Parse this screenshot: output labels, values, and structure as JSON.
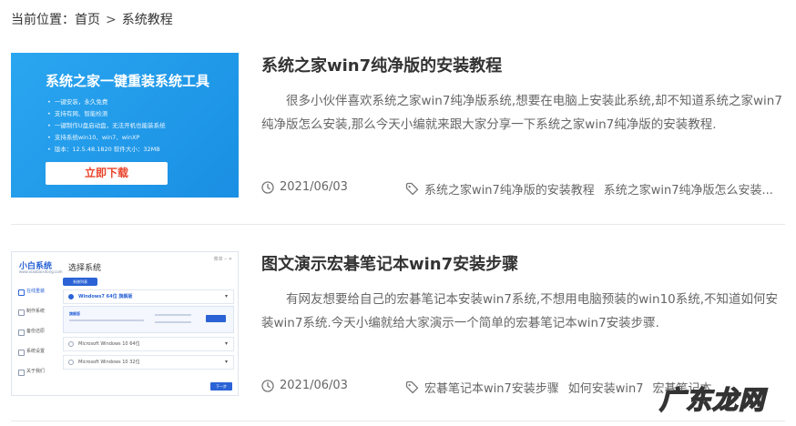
{
  "breadcrumb": {
    "prefix": "当前位置：",
    "home": "首页",
    "separator": ">",
    "current": "系统教程"
  },
  "articles": [
    {
      "title": "系统之家win7纯净版的安装教程",
      "excerpt": "很多小伙伴喜欢系统之家win7纯净版系统,想要在电脑上安装此系统,却不知道系统之家win7纯净版怎么安装,那么今天小编就来跟大家分享一下系统之家win7纯净版的安装教程.",
      "date": "2021/06/03",
      "tags": [
        "系统之家win7纯净版的安装教程",
        "系统之家win7纯净版怎么安装..."
      ],
      "thumb": {
        "title": "系统之家一键重装系统工具",
        "bullets": [
          "一键安装，永久免费",
          "支持有网、智能检测",
          "一键制作U盘启动盘，无法开机也能装系统",
          "支持系统win10、win7、winXP",
          "版本：12.5.48.1820  软件大小：32MB"
        ],
        "button": "立即下载"
      }
    },
    {
      "title": "图文演示宏碁笔记本win7安装步骤",
      "excerpt": "有网友想要给自己的宏碁笔记本安装win7系统,不想用电脑预装的win10系统,不知道如何安装win7系统.今天小编就给大家演示一个简单的宏碁笔记本win7安装步骤.",
      "date": "2021/06/03",
      "tags": [
        "宏碁笔记本win7安装步骤",
        "如何安装win7",
        "宏碁笔记本"
      ],
      "thumb": {
        "logo": "小白系统",
        "logo_sub": "www.xiaobaixitong.com",
        "window_title": "选择系统",
        "window_controls": "菜单 ─ ✕",
        "sidebar": [
          "在线重装",
          "制作系统",
          "备份还原",
          "系统设置",
          "关于我们"
        ],
        "tab": "系统列表",
        "options": [
          "Windows7 64位 旗舰版",
          "Microsoft Windows 10 64位",
          "Microsoft Windows 10 32位"
        ],
        "sub_label": "旗舰版",
        "next": "下一步"
      }
    }
  ],
  "watermark": "广东龙网",
  "colors": {
    "accent": "#2b63d6",
    "banner": "#1a8fe3",
    "download": "#e8452c"
  }
}
